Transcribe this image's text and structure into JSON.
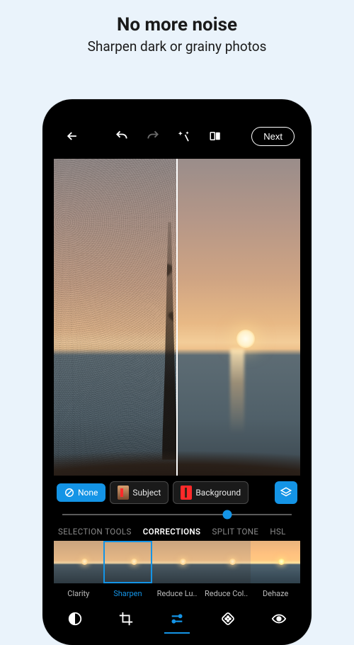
{
  "promo": {
    "title": "No more noise",
    "subtitle": "Sharpen dark or grainy photos"
  },
  "topbar": {
    "next_label": "Next"
  },
  "masks": {
    "none": "None",
    "subject": "Subject",
    "background": "Background"
  },
  "slider": {
    "value_percent": 72
  },
  "categories": {
    "selection_tools": "SELECTION TOOLS",
    "corrections": "CORRECTIONS",
    "split_tone": "SPLIT TONE",
    "hsl": "HSL"
  },
  "filters": {
    "clarity": "Clarity",
    "sharpen": "Sharpen",
    "reduce_luminance": "Reduce Lu..",
    "reduce_color": "Reduce Col..",
    "dehaze": "Dehaze"
  }
}
